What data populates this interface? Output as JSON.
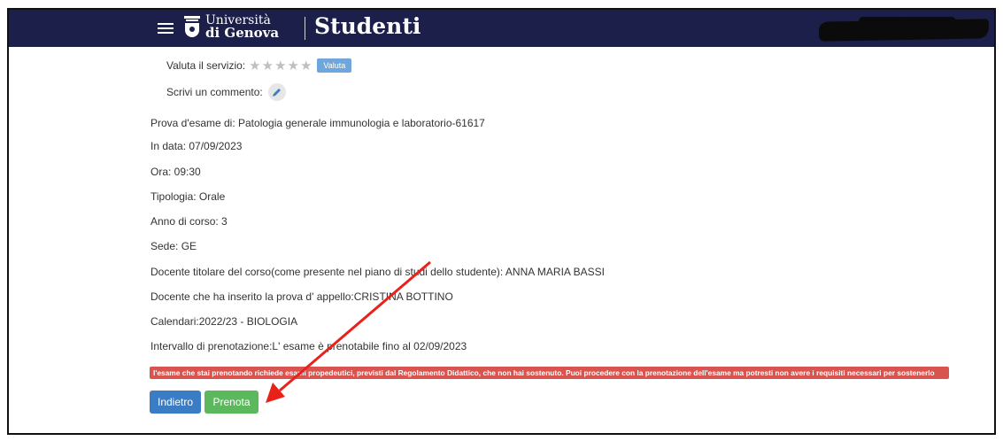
{
  "header": {
    "logo_line1": "Università",
    "logo_line2": "di Genova",
    "app_title": "Studenti"
  },
  "rating": {
    "label": "Valuta il servizio:",
    "stars": 5,
    "button_label": "Valuta"
  },
  "comment": {
    "label": "Scrivi un commento:"
  },
  "exam_details": [
    "Prova d'esame di: Patologia generale immunologia e laboratorio-61617",
    "In data: 07/09/2023",
    "Ora: 09:30",
    "Tipologia: Orale",
    "Anno di corso: 3",
    "Sede: GE",
    "Docente titolare del corso(come presente nel piano di studi dello studente): ANNA MARIA BASSI",
    "Docente che ha inserito la prova d' appello:CRISTINA BOTTINO",
    "Calendari:2022/23 - BIOLOGIA",
    "Intervallo di prenotazione:L' esame è prenotabile fino al 02/09/2023"
  ],
  "warning": "l'esame che stai prenotando richiede esami propedeutici, previsti dal Regolamento Didattico, che non hai sostenuto. Puoi procedere con la prenotazione dell'esame ma potresti non avere i requisiti necessari per sostenerlo",
  "actions": {
    "back_label": "Indietro",
    "book_label": "Prenota"
  },
  "colors": {
    "header_bg": "#1c1f4a",
    "primary": "#3b7dc4",
    "success": "#5cb85c",
    "danger": "#d9534f",
    "annotation_arrow": "#e8211b"
  }
}
